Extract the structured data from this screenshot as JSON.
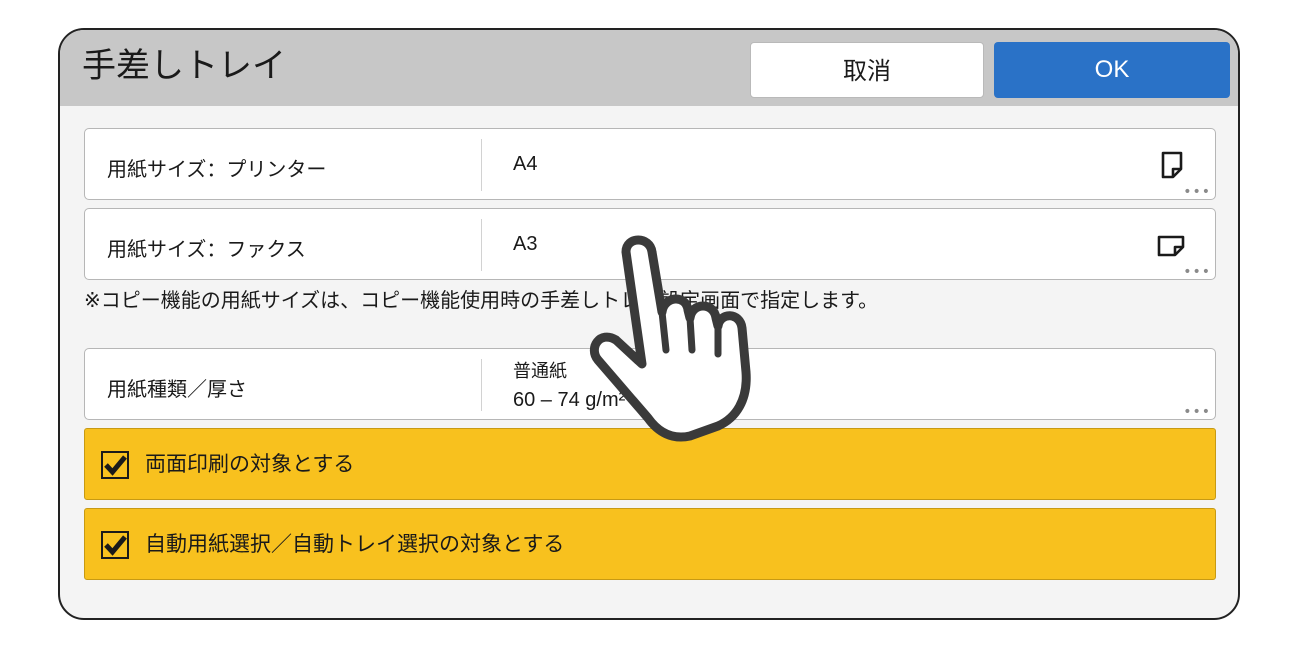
{
  "dialog": {
    "title": "手差しトレイ",
    "cancel_label": "取消",
    "ok_label": "OK"
  },
  "rows": [
    {
      "label": "用紙サイズ：プリンター",
      "value": "A4",
      "icon": "paper-portrait-icon"
    },
    {
      "label": "用紙サイズ：ファクス",
      "value": "A3",
      "icon": "paper-landscape-icon"
    }
  ],
  "note": "※コピー機能の用紙サイズは、コピー機能使用時の手差しトレイ設定画面で指定します。",
  "paper_type": {
    "label": "用紙種類／厚さ",
    "value_line1": "普通紙",
    "value_line2": "60 – 74 g/m² (厚さ 1)"
  },
  "checkboxes": [
    {
      "label": "両面印刷の対象とする",
      "checked": true
    },
    {
      "label": "自動用紙選択／自動トレイ選択の対象とする",
      "checked": true
    }
  ],
  "colors": {
    "header_bg": "#c7c7c7",
    "ok_button": "#2a72c7",
    "checkbox_row": "#f8c11e"
  },
  "overlay": {
    "icon": "pointing-hand-icon"
  }
}
